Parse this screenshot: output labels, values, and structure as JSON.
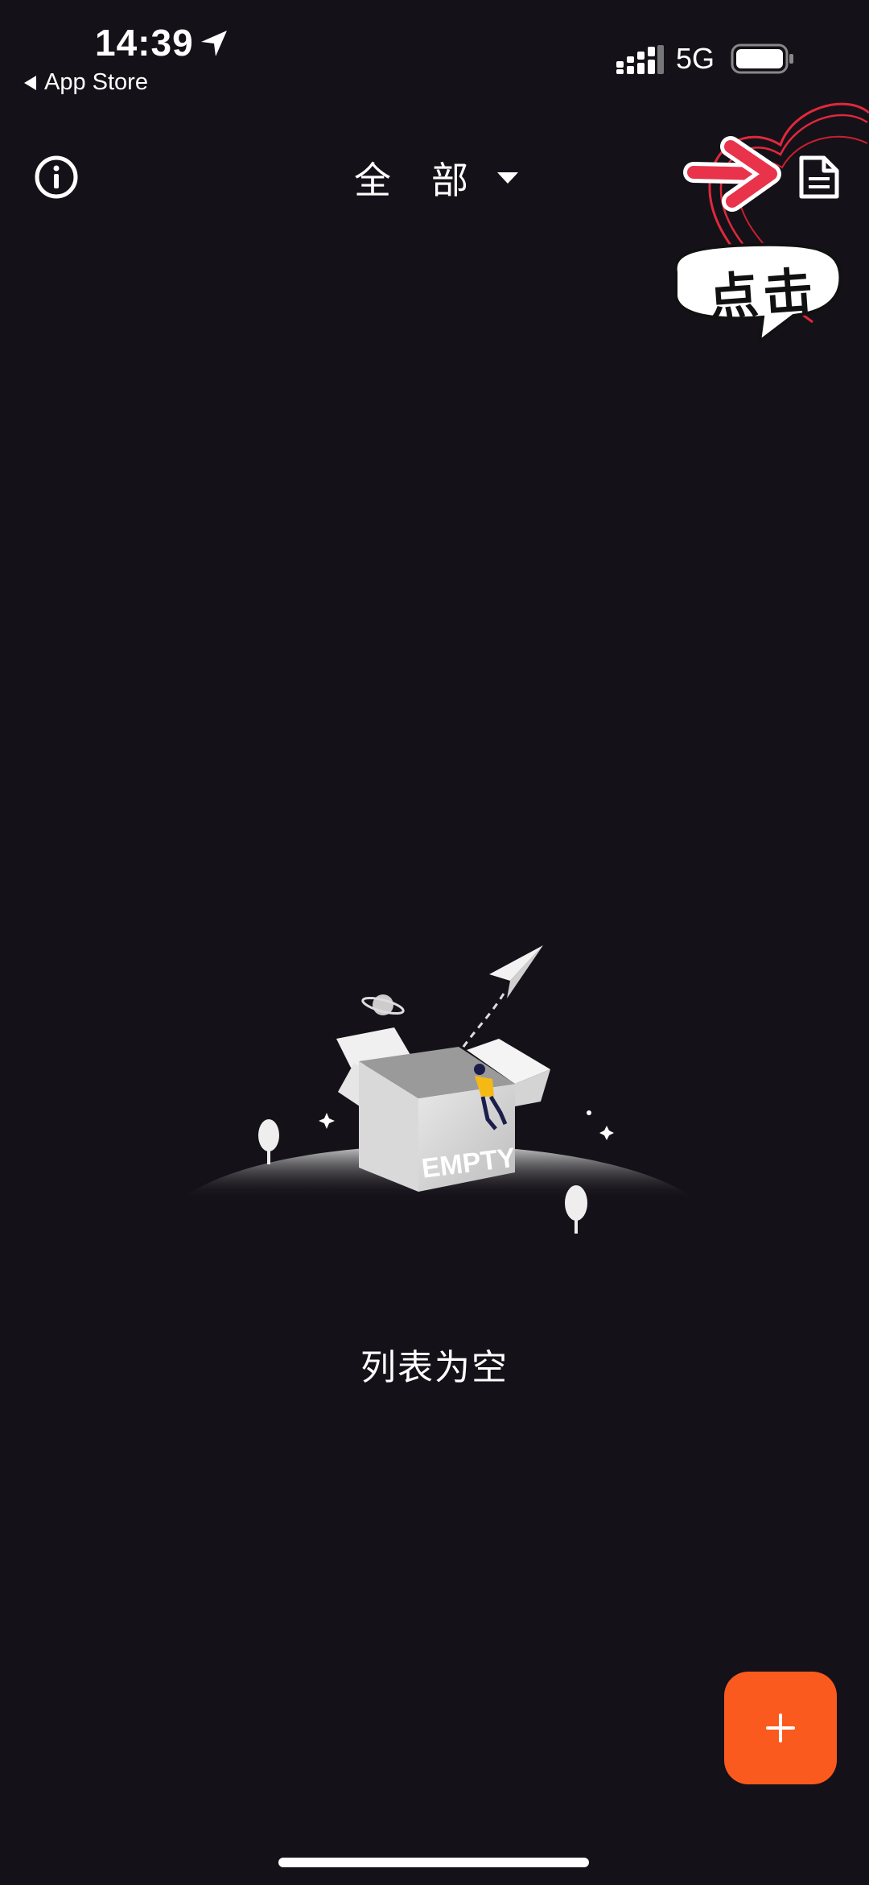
{
  "status_bar": {
    "time": "14:39",
    "back_label": "App Store",
    "network": "5G",
    "location_icon": "location-arrow-icon",
    "signal_icon": "signal-bars-icon",
    "battery_icon": "battery-icon"
  },
  "header": {
    "title": "全部",
    "left_icon": "info-icon",
    "right_icon": "document-icon",
    "title_dropdown_icon": "caret-down-icon"
  },
  "annotation": {
    "sticker_text": "点击",
    "arrow_color": "#e8334a",
    "heart_color": "#e0283c"
  },
  "empty_state": {
    "illustration_label": "EMPTY",
    "message": "列表为空"
  },
  "fab": {
    "icon": "plus-icon",
    "color": "#fb5a1f"
  }
}
